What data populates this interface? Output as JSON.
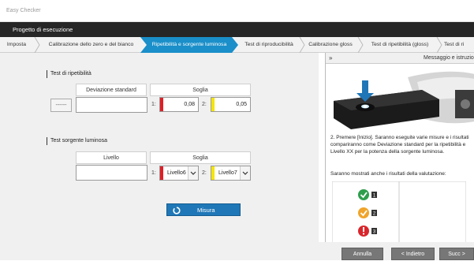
{
  "app": {
    "title": "Easy Checker"
  },
  "header": {
    "title": "Progetto di esecuzione"
  },
  "tabs": [
    {
      "label": "Imposta"
    },
    {
      "label": "Calibrazione dello zero e del bianco"
    },
    {
      "label": "Ripetibilità e sorgente luminosa",
      "active": true
    },
    {
      "label": "Test di riproducibilità"
    },
    {
      "label": "Calibrazione gloss"
    },
    {
      "label": "Test di ripetibilità (gloss)"
    },
    {
      "label": "Test di ri"
    }
  ],
  "repeatability": {
    "section_label": "Test di ripetibilità",
    "col_std": "Deviazione standard",
    "col_threshold": "Soglia",
    "dash_button": "------",
    "threshold1_index": "1:",
    "threshold1_value": "0,08",
    "threshold2_index": "2:",
    "threshold2_value": "0,05"
  },
  "light_source": {
    "section_label": "Test sorgente luminosa",
    "col_level": "Livello",
    "col_threshold": "Soglia",
    "threshold1_index": "1:",
    "threshold1_value": "Livello6",
    "threshold2_index": "2:",
    "threshold2_value": "Livello7"
  },
  "measure_button": {
    "label": "Misura"
  },
  "instructions": {
    "header_title": "Messaggio e istruzio",
    "step_text": "2. Premere [Inizio]. Saranno eseguite varie misure e i risultati compariranno come Deviazione standard per la ripetibilità e Livello XX per la potenza della sorgente luminosa.",
    "eval_text": "Saranno mostrati anche i risultati della valutazione:",
    "eval_rows": [
      {
        "icon": "check-circle-icon",
        "rank": "1",
        "color": "#2e9e4d"
      },
      {
        "icon": "warning-circle-icon",
        "rank": "2",
        "color": "#f0a42a"
      },
      {
        "icon": "exclamation-circle-icon",
        "rank": "3",
        "color": "#d9262c"
      }
    ]
  },
  "footer": {
    "cancel": "Annulla",
    "back": "< Indietro",
    "next": "Succ >"
  },
  "colors": {
    "accent": "#1f77b7",
    "active_tab": "#1a8fc9",
    "marker_red": "#e01f26",
    "marker_yellow": "#f5e400",
    "dark_bar": "#262626"
  }
}
